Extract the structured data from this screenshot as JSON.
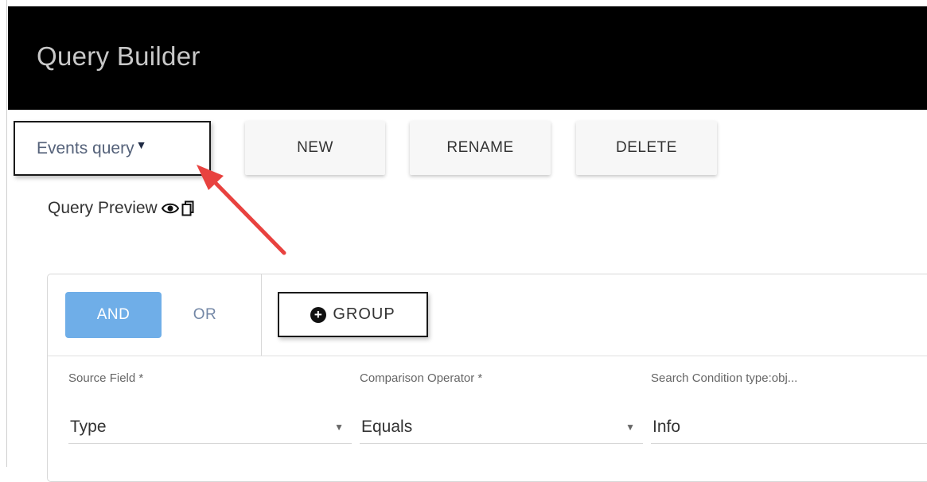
{
  "header": {
    "title": "Query Builder"
  },
  "query_selector": {
    "label": "Events query",
    "icon": "caret-down-icon"
  },
  "toolbar": {
    "new_label": "NEW",
    "rename_label": "RENAME",
    "delete_label": "DELETE"
  },
  "preview": {
    "label": "Query Preview",
    "icons": [
      "eye-icon",
      "copy-icon"
    ]
  },
  "group_panel": {
    "and_label": "AND",
    "or_label": "OR",
    "add_group_label": "GROUP",
    "active_logic": "AND"
  },
  "rule": {
    "source_field": {
      "label": "Source Field *",
      "value": "Type"
    },
    "comparison_operator": {
      "label": "Comparison Operator *",
      "value": "Equals"
    },
    "search_condition": {
      "label": "Search Condition type:obj...",
      "value": "Info"
    }
  },
  "colors": {
    "header_bg": "#000000",
    "and_active": "#6faee8",
    "annotation_arrow": "#e8423f"
  }
}
